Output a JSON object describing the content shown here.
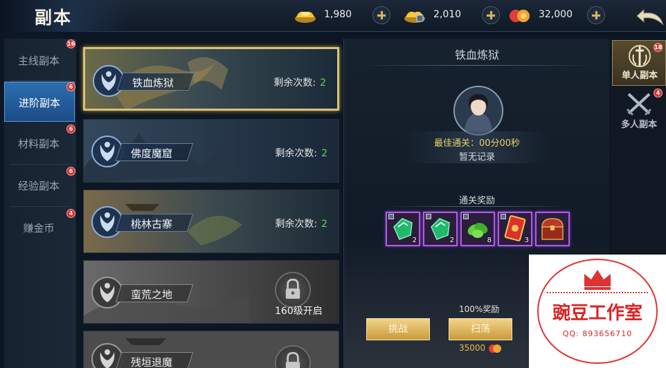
{
  "header": {
    "title": "副本",
    "currencies": [
      {
        "name": "gold-ingot-icon",
        "value": "1,980"
      },
      {
        "name": "bound-ingot-icon",
        "value": "2,010"
      },
      {
        "name": "coin-bag-icon",
        "value": "32,000"
      }
    ]
  },
  "left_nav": [
    {
      "label": "主线副本",
      "badge": "16",
      "active": false
    },
    {
      "label": "进阶副本",
      "badge": "6",
      "active": true
    },
    {
      "label": "材料副本",
      "badge": "6",
      "active": false
    },
    {
      "label": "经验副本",
      "badge": "6",
      "active": false
    },
    {
      "label": "赚金币",
      "badge": "4",
      "active": false
    }
  ],
  "dungeons": [
    {
      "name": "铁血炼狱",
      "remain_label": "剩余次数:",
      "remain": "2",
      "locked": false,
      "selected": true
    },
    {
      "name": "佛度魔窟",
      "remain_label": "剩余次数:",
      "remain": "2",
      "locked": false,
      "selected": false
    },
    {
      "name": "桃林古寨",
      "remain_label": "剩余次数:",
      "remain": "2",
      "locked": false,
      "selected": false
    },
    {
      "name": "蛮荒之地",
      "unlock": "160级开启",
      "locked": true,
      "selected": false
    },
    {
      "name": "残垣退魔",
      "locked": true,
      "selected": false
    }
  ],
  "detail": {
    "title": "铁血炼狱",
    "best_clear": "最佳通关：00分00秒",
    "no_record": "暂无记录",
    "reward_title": "通关奖励",
    "rewards": [
      {
        "item": "green-gem-icon",
        "count": "2"
      },
      {
        "item": "green-gem-icon",
        "count": "2"
      },
      {
        "item": "green-herb-icon",
        "count": "8"
      },
      {
        "item": "red-card-icon",
        "count": "3"
      },
      {
        "item": "treasure-chest-icon",
        "count": ""
      }
    ],
    "bonus": "100%奖励",
    "challenge_label": "挑战",
    "sweep_label": "扫荡",
    "sweep_cost": "35000"
  },
  "right_tabs": [
    {
      "label": "单人副本",
      "badge": "18",
      "active": true
    },
    {
      "label": "多人副本",
      "badge": "4",
      "active": false
    }
  ],
  "watermark": {
    "text": "豌豆工作室",
    "qq": "QQ: 893656710"
  },
  "colors": {
    "accent_gold": "#d8c27a",
    "remain_green": "#5fd65b",
    "badge_red": "#d93030",
    "reward_purple": "#b35be8",
    "nav_active_blue": "#2b6fb0"
  }
}
